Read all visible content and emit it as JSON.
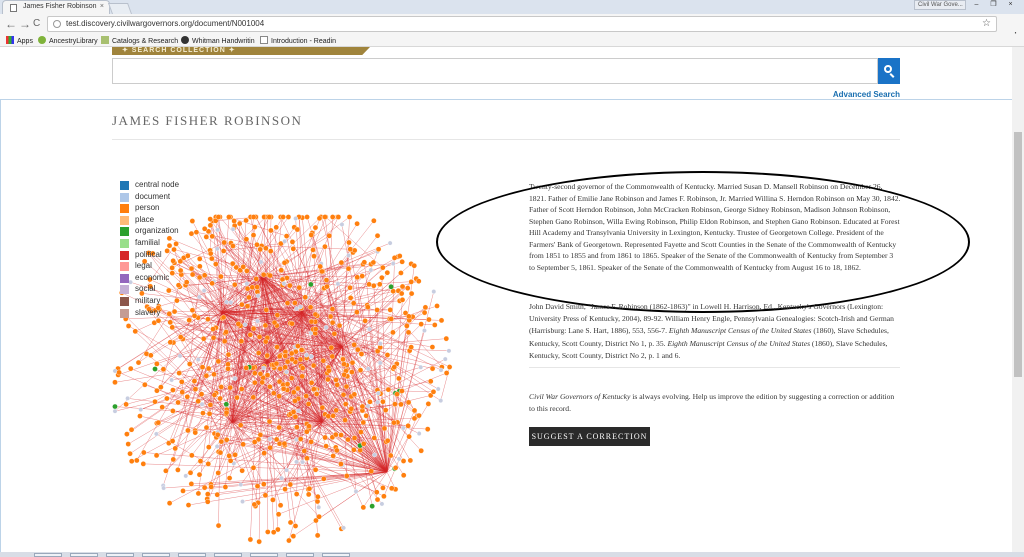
{
  "browser": {
    "tab_title": "James Fisher Robinson",
    "tab_close": "×",
    "user_chip": "Civil War Gove...",
    "window_buttons": [
      "–",
      "❐",
      "×"
    ],
    "url": "test.discovery.civilwargovernors.org/document/N001004",
    "nav": {
      "back": "←",
      "forward": "→",
      "reload": "C"
    },
    "star": "☆",
    "menu": "⋮",
    "bookmarks": [
      "Apps",
      "AncestryLibrary",
      "Catalogs & Research",
      "Whitman Handwritin",
      "Introduction - Readin"
    ]
  },
  "search": {
    "tab_label": "✦ SEARCH COLLECTION ✦",
    "advanced_link": "Advanced Search"
  },
  "document": {
    "title": "JAMES FISHER ROBINSON",
    "bio": "Twenty-second governor of the Commonwealth of Kentucky. Married Susan D. Mansell Robinson on December 26, 1821. Father of Emilie Jane Robinson and James F. Robinson, Jr. Married Willina S. Herndon Robinson on May 30, 1842. Father of Scott Herndon Robinson, John McCracken Robinson, George Sidney Robinson, Madison Johnson Robinson, Stephen Gano Robinson, Willa Ewing Robinson, Philip Eldon Robinson, and Stephen Gano Robinson. Educated at Forest Hill Academy and Transylvania University in Lexington, Kentucky. Trustee of Georgetown College. President of the Farmers' Bank of Georgetown. Represented Fayette and Scott Counties in the Senate of the Commonwealth of Kentucky from 1851 to 1855 and from 1861 to 1865. Speaker of the Senate of the Commonwealth of Kentucky from September 3 to September 5, 1861. Speaker of the Senate of the Commonwealth of Kentucky from August 16 to 18, 1862.",
    "cite_1": "John David Smith, \"James F. Robinson (1862-1863)\" in Lowell H. Harrison, Ed., Kentucky's Governors (Lexington: University Press of Kentucky, 2004), 89-92. William Henry Engle, Pennsylvania Genealogies: Scotch-Irish and German (Harrisburg: Lane S. Hart, 1886), 553, 556-7. ",
    "cite_em_1": "Eighth Manuscript Census of the United States",
    "cite_2": " (1860), Slave Schedules, Kentucky, Scott County, District No 1, p. 35. ",
    "cite_em_2": "Eighth Manuscript Census of the United States",
    "cite_3": " (1860), Slave Schedules, Kentucky, Scott County, District No 2, p. 1 and 6.",
    "evolve_em": "Civil War Governors of Kentucky",
    "evolve_text": " is always evolving. Help us improve the edition by suggesting a correction or addition to this record.",
    "suggest_button": "SUGGEST A CORRECTION"
  },
  "legend": [
    {
      "label": "central node",
      "color": "#1f77b4"
    },
    {
      "label": "document",
      "color": "#aec7e8"
    },
    {
      "label": "person",
      "color": "#ff7f0e"
    },
    {
      "label": "place",
      "color": "#ffbb78"
    },
    {
      "label": "organization",
      "color": "#2ca02c"
    },
    {
      "label": "familial",
      "color": "#98df8a"
    },
    {
      "label": "political",
      "color": "#d62728"
    },
    {
      "label": "legal",
      "color": "#ff9896"
    },
    {
      "label": "economic",
      "color": "#9467bd"
    },
    {
      "label": "social",
      "color": "#c5b0d5"
    },
    {
      "label": "military",
      "color": "#8c564b"
    },
    {
      "label": "slavery",
      "color": "#c49c94"
    }
  ],
  "colors": {
    "edge": "#d62728",
    "person_node": "#ff7f0e",
    "doc_node": "#c7cde0",
    "org_node": "#2ca02c",
    "search_blue": "#1a73c7",
    "gold": "#a0843c"
  }
}
